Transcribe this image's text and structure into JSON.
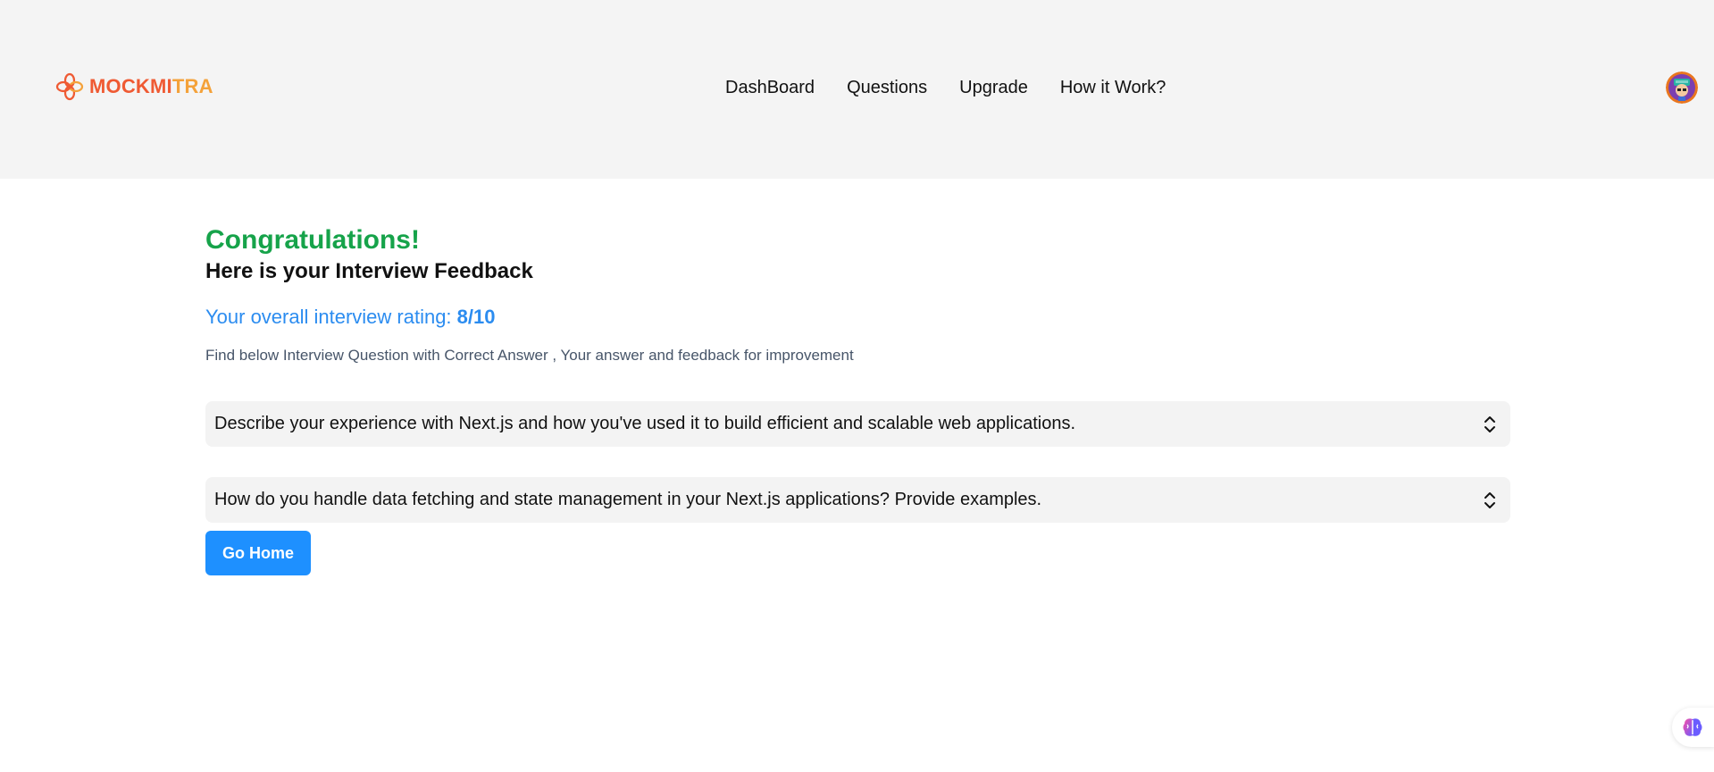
{
  "header": {
    "logo_text_main": "MOCKMI",
    "logo_text_tail": "TRA",
    "nav": [
      {
        "label": "DashBoard"
      },
      {
        "label": "Questions"
      },
      {
        "label": "Upgrade"
      },
      {
        "label": "How it Work?"
      }
    ],
    "avatar_icon": "user-avatar-icon"
  },
  "main": {
    "congrats": "Congratulations!",
    "subtitle": "Here is your Interview Feedback",
    "rating_label": "Your overall interview rating: ",
    "rating_value": "8/10",
    "hint": "Find below Interview Question with Correct Answer , Your answer and feedback for improvement",
    "questions": [
      {
        "text": "Describe your experience with Next.js and how you've used it to build efficient and scalable web applications."
      },
      {
        "text": "How do you handle data fetching and state management in your Next.js applications? Provide examples."
      }
    ],
    "go_home_label": "Go Home"
  },
  "colors": {
    "header_bg": "#f4f4f4",
    "congrats": "#16a34a",
    "rating": "#2b8cf0",
    "button": "#1e90ff",
    "logo_primary": "#ef5a33",
    "logo_secondary": "#f4a23a"
  },
  "floating": {
    "icon": "brain-icon"
  }
}
